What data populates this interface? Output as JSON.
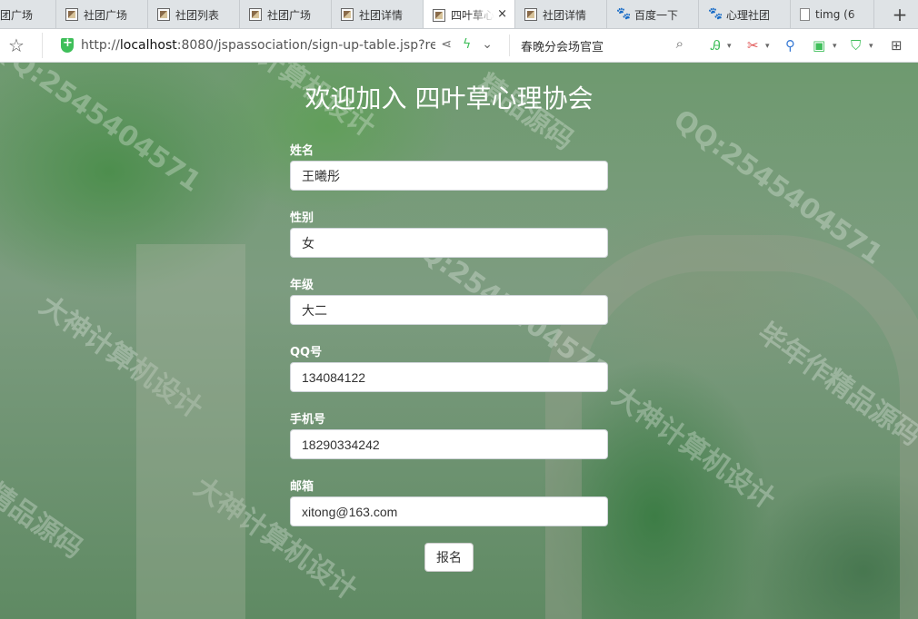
{
  "browser": {
    "tabs": [
      {
        "label": "团广场",
        "icon": "none"
      },
      {
        "label": "社团广场",
        "icon": "page-thumb-icon"
      },
      {
        "label": "社团列表",
        "icon": "page-thumb-icon"
      },
      {
        "label": "社团广场",
        "icon": "page-thumb-icon"
      },
      {
        "label": "社团详情",
        "icon": "page-thumb-icon"
      },
      {
        "label": "四叶草心",
        "icon": "page-thumb-icon",
        "active": true
      },
      {
        "label": "社团详情",
        "icon": "page-thumb-icon"
      },
      {
        "label": "百度一下",
        "icon": "paw-icon"
      },
      {
        "label": "心理社团",
        "icon": "paw-icon"
      },
      {
        "label": "timg (6",
        "icon": "file-icon"
      }
    ],
    "tab_close": "×",
    "new_tab": "+",
    "url_prefix": "http://",
    "url_host": "localhost",
    "url_rest": ":8080/jspassociation/sign-up-table.jsp?rec",
    "search_text": "春晚分会场官宣"
  },
  "form": {
    "title": "欢迎加入 四叶草心理协会",
    "fields": [
      {
        "label": "姓名",
        "value": "王曦彤"
      },
      {
        "label": "性别",
        "value": "女"
      },
      {
        "label": "年级",
        "value": "大二"
      },
      {
        "label": "QQ号",
        "value": "134084122"
      },
      {
        "label": "手机号",
        "value": "18290334242"
      },
      {
        "label": "邮箱",
        "value": "xitong@163.com"
      }
    ],
    "submit_label": "报名"
  },
  "watermarks": [
    "QQ:2545404571",
    "大神计算机设计",
    "精品源码",
    "QQ:2545404571",
    "大神计算机设计",
    "毕年作精品源码",
    "QQ:2545404571",
    "大神计算机设计",
    "精品源码",
    "大神计算机设计"
  ],
  "colors": {
    "accent_green": "#3fbf5a",
    "page_bg": "#6e9a6f"
  }
}
